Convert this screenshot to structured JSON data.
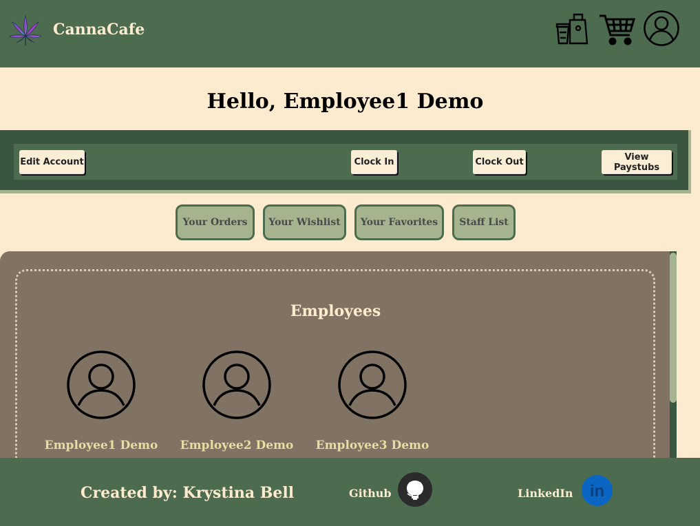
{
  "header": {
    "brand": "CannaCafe",
    "icons": [
      "cannabis-leaf-logo",
      "coffee-bag-icon",
      "cart-icon",
      "user-profile-icon"
    ]
  },
  "greeting": "Hello, Employee1 Demo",
  "toolbar": {
    "edit_account": "Edit Account",
    "clock_in": "Clock In",
    "clock_out": "Clock Out",
    "view_paystubs": "View Paystubs"
  },
  "tabs": [
    "Your Orders",
    "Your Wishlist",
    "Your Favorites",
    "Staff List"
  ],
  "staff": {
    "title": "Employees",
    "employees": [
      {
        "name": "Employee1 Demo",
        "icon": "user-avatar-icon"
      },
      {
        "name": "Employee2 Demo",
        "icon": "user-avatar-icon"
      },
      {
        "name": "Employee3 Demo",
        "icon": "user-avatar-icon"
      }
    ]
  },
  "footer": {
    "credit": "Created by: Krystina Bell",
    "github_label": "Github",
    "linkedin_label": "LinkedIn",
    "linkedin_glyph": "in"
  },
  "colors": {
    "header_bg": "#4c6b4f",
    "page_bg": "#fdebd0",
    "panel_bg": "#817363",
    "tab_bg": "#a5b48e",
    "accent_name": "#e7dca2",
    "linkedin": "#0a66c2"
  }
}
